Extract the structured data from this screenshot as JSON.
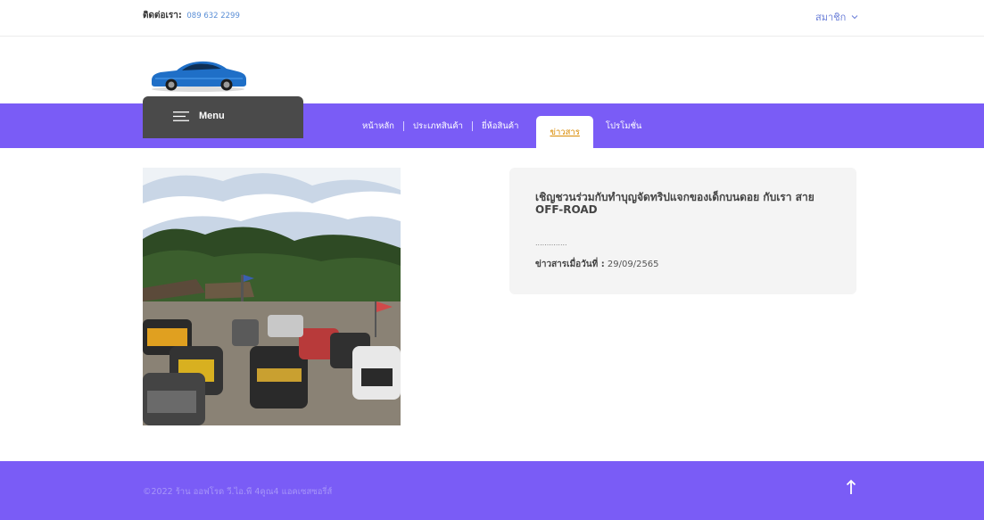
{
  "header": {
    "contact_label": "ติดต่อเรา:",
    "contact_phone": "089 632 2299",
    "member_label": "สมาชิก"
  },
  "menu": {
    "label": "Menu"
  },
  "nav": {
    "items": [
      {
        "label": "หน้าหลัก"
      },
      {
        "label": "ประเภทสินค้า"
      },
      {
        "label": "ยี่ห้อสินค้า"
      },
      {
        "label": "ข่าวสาร",
        "active": true
      },
      {
        "label": "โปรโมชั่น"
      }
    ]
  },
  "news": {
    "title": "เชิญชวนร่วมกับทำบุญจัดทริปแจกของเด็กบนดอย กับเรา สาย OFF-ROAD",
    "dots": "..............",
    "date_label": "ข่าวสารเมื่อวันที่ :",
    "date_value": "29/09/2565"
  },
  "footer": {
    "copyright": "©2022 ร้าน ออฟโรด วี.ไอ.พี 4คูณ4 แอคเซสซอรี่ส์"
  },
  "colors": {
    "accent": "#7a5cf6",
    "menu_bg": "#4a4a4a",
    "active_link": "#d98a00",
    "phone": "#5b8fd6"
  },
  "icons": {
    "member_chevron": "chevron-down-icon",
    "hamburger": "hamburger-icon",
    "back_to_top": "arrow-up-icon"
  }
}
